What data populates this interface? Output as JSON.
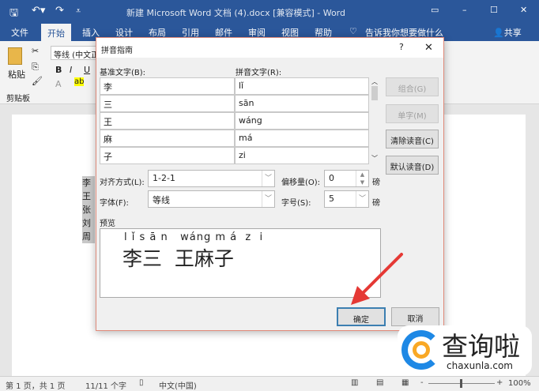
{
  "window": {
    "title": "新建 Microsoft Word 文档 (4).docx [兼容模式] - Word"
  },
  "tabs": [
    "文件",
    "开始",
    "插入",
    "设计",
    "布局",
    "引用",
    "邮件",
    "审阅",
    "视图",
    "帮助"
  ],
  "tell_me": "告诉我你想要做什么",
  "share": "共享",
  "ribbon": {
    "font_name": "等线 (中文正",
    "paste": "粘贴",
    "clipboard": "剪贴板",
    "bold": "B",
    "italic": "I",
    "underline": "U"
  },
  "document": {
    "lines": [
      "李",
      "王",
      "张",
      "刘",
      "周"
    ]
  },
  "dialog": {
    "title": "拼音指南",
    "help": "?",
    "close": "✕",
    "base_label": "基准文字(B):",
    "ruby_label": "拼音文字(R):",
    "rows": [
      {
        "base": "李",
        "ruby": "lǐ"
      },
      {
        "base": "三",
        "ruby": "sān"
      },
      {
        "base": "王",
        "ruby": "wáng"
      },
      {
        "base": "麻",
        "ruby": "má"
      },
      {
        "base": "子",
        "ruby": "zi"
      }
    ],
    "buttons": {
      "group": "组合(G)",
      "mono": "单字(M)",
      "clear": "清除读音(C)",
      "default": "默认读音(D)",
      "ok": "确定",
      "cancel": "取消"
    },
    "align_label": "对齐方式(L):",
    "align_value": "1-2-1",
    "offset_label": "偏移量(O):",
    "offset_value": "0",
    "offset_unit": "磅",
    "font_label": "字体(F):",
    "font_value": "等线",
    "size_label": "字号(S):",
    "size_value": "5",
    "size_unit": "磅",
    "preview_label": "预览",
    "preview_ruby": "l ǐ s ā n   wáng m á  z  i",
    "preview_text": "李三  王麻子"
  },
  "status": {
    "page": "第 1 页，共 1 页",
    "words": "11/11 个字",
    "lang": "中文(中国)",
    "zoom": "100%"
  },
  "watermark": {
    "text": "查询啦",
    "domain": "chaxunla.com"
  },
  "colors": {
    "word_blue": "#2b579a",
    "arrow": "#e53935"
  }
}
